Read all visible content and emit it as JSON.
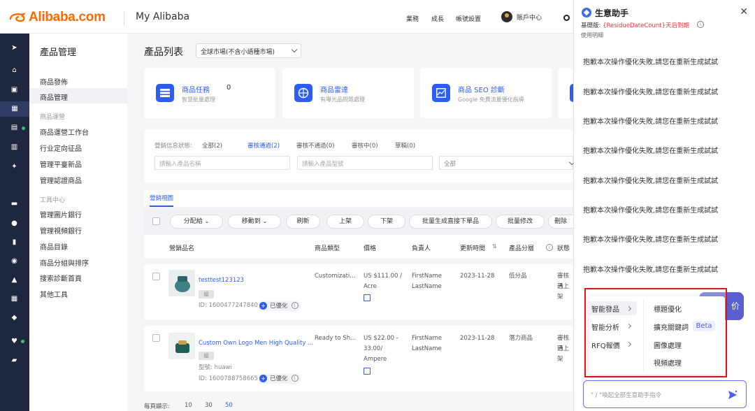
{
  "header": {
    "logo": "Alibaba.com",
    "title": "My Alibaba",
    "nav": [
      "業務",
      "成長",
      "帳號設置"
    ],
    "account": "賬戶中心"
  },
  "menu": {
    "title": "產品管理",
    "items1": [
      "商品發佈",
      "商品管理"
    ],
    "group2": "商品運營",
    "items2": [
      "商品運營工作台",
      "行业定向征品",
      "管理平臺新品",
      "管理認證商品"
    ],
    "group3": "工具中心",
    "items3": [
      "管理圖片銀行",
      "管理視頻銀行",
      "商品目錄",
      "商品分組與排序",
      "搜索診斷首頁",
      "其他工具"
    ]
  },
  "page": {
    "title": "產品列表",
    "market": "全球市場(不含小語種市場)"
  },
  "cards": [
    {
      "title": "商品任務",
      "count": "0",
      "sub": "智慧批量處理"
    },
    {
      "title": "商品雷達",
      "sub": "有曝光品問題處理"
    },
    {
      "title": "商品 SEO 診斷",
      "sub": "Google 免費流量優化指導"
    }
  ],
  "filter": {
    "label": "營銷信息狀態:",
    "statuses": [
      "全部(2)",
      "審核通過(2)",
      "審核不通過(0)",
      "審核中(0)",
      "草稿(0)"
    ],
    "name_ph": "請輸入產品名稱",
    "model_ph": "請輸入產品型號",
    "select": "全部"
  },
  "tab": "營銷視圖",
  "actions": [
    "分配給",
    "移動到",
    "刷新",
    "上架",
    "下架",
    "批量生成直接下單品",
    "批量修改",
    "刪除"
  ],
  "columns": [
    "營銷品名",
    "商品類型",
    "價格",
    "負責人",
    "更新時間",
    "產品分層",
    "狀態"
  ],
  "rows": [
    {
      "name": "testtest123123",
      "tag": "組",
      "id": "ID: 1600477247840",
      "optimized": "已優化",
      "type": "Customizati...",
      "price": [
        "US $111.00 /",
        "Acre"
      ],
      "owner": [
        "FirstName",
        "LastName"
      ],
      "date": "2023-11-28",
      "tier": "低分品",
      "status": [
        "審核通",
        "已上架"
      ]
    },
    {
      "name": "Custom Own Logo Men High Quality ...",
      "tag": "組",
      "model": "型號: huawi",
      "id": "ID: 1600788758665",
      "optimized": "已優化",
      "type": "Ready to Sh...",
      "price": [
        "US $22.00 -",
        "33.00/",
        "Ampere"
      ],
      "owner": [
        "FirstName",
        "LastName"
      ],
      "date": "2023-11-28",
      "tier": "潛力商品",
      "status": [
        "審核通",
        "已上架"
      ]
    }
  ],
  "pager": {
    "label": "每頁顯示:",
    "sizes": [
      "10",
      "30",
      "50"
    ]
  },
  "assistant": {
    "title": "生意助手",
    "sub_prefix": "基礎版:",
    "sub_warn": "{ResidueDateCount}天后到期",
    "guide": "使用明細",
    "messages": [
      "抱歉本次操作優化失敗,請您在重新生成試試",
      "抱歉本次操作優化失敗,請您在重新生成試試",
      "抱歉本次操作優化失敗,請您在重新生成試試",
      "抱歉本次操作優化失敗,請您在重新生成試試",
      "抱歉本次操作優化失敗,請您在重新生成試試",
      "抱歉本次操作優化失敗,請您在重新生成試試",
      "抱歉本次操作優化失敗,請您在重新生成試試",
      "抱歉本次操作優化失敗,請您在重新生成試試"
    ],
    "price_btn": "价",
    "menu_left": [
      "智能發品",
      "智能分析",
      "RFQ報價"
    ],
    "menu_right": [
      "標題優化",
      "擴充關鍵詞",
      "圖像處理",
      "視頻處理"
    ],
    "beta": "Beta",
    "input_ph": "\" / \"喚起全部生意助手指令"
  },
  "colors": {
    "brand": "#ff6a00",
    "primary": "#2e5cf6",
    "sidebar": "#1f2640",
    "highlight": "#e2141c"
  }
}
